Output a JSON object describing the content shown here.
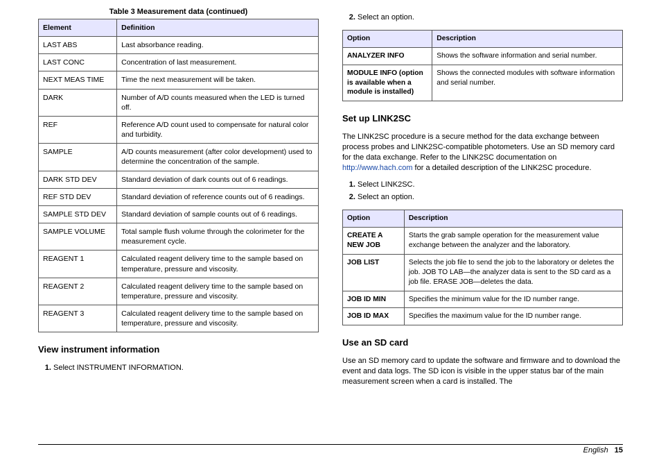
{
  "left": {
    "table_caption": "Table 3  Measurement data (continued)",
    "head": {
      "c1": "Element",
      "c2": "Definition"
    },
    "rows": [
      {
        "c1": "LAST ABS",
        "c2": "Last absorbance reading."
      },
      {
        "c1": "LAST CONC",
        "c2": "Concentration of last measurement."
      },
      {
        "c1": "NEXT MEAS TIME",
        "c2": "Time the next measurement will be taken."
      },
      {
        "c1": "DARK",
        "c2": "Number of A/D counts measured when the LED is turned off."
      },
      {
        "c1": "REF",
        "c2": "Reference A/D count used to compensate for natural color and turbidity."
      },
      {
        "c1": "SAMPLE",
        "c2": "A/D counts measurement (after color development) used to determine the concentration of the sample."
      },
      {
        "c1": "DARK STD DEV",
        "c2": "Standard deviation of dark counts out of 6 readings."
      },
      {
        "c1": "REF STD DEV",
        "c2": "Standard deviation of reference counts out of 6 readings."
      },
      {
        "c1": "SAMPLE STD DEV",
        "c2": "Standard deviation of sample counts out of 6 readings."
      },
      {
        "c1": "SAMPLE VOLUME",
        "c2": "Total sample flush volume through the colorimeter for the measurement cycle."
      },
      {
        "c1": "REAGENT 1",
        "c2": "Calculated reagent delivery time to the sample based on temperature, pressure and viscosity."
      },
      {
        "c1": "REAGENT 2",
        "c2": "Calculated reagent delivery time to the sample based on temperature, pressure and viscosity."
      },
      {
        "c1": "REAGENT 3",
        "c2": "Calculated reagent delivery time to the sample based on temperature, pressure and viscosity."
      }
    ],
    "heading": "View instrument information",
    "step1": "Select INSTRUMENT INFORMATION."
  },
  "right": {
    "step2": "Select an option.",
    "table1": {
      "head": {
        "c1": "Option",
        "c2": "Description"
      },
      "rows": [
        {
          "c1": "ANALYZER INFO",
          "c2": "Shows the software information and serial number."
        },
        {
          "c1": "MODULE INFO (option is available when a module is installed)",
          "c2": "Shows the connected modules with software information and serial number."
        }
      ]
    },
    "heading1": "Set up LINK2SC",
    "para1a": "The LINK2SC procedure is a secure method for the data exchange between process probes and LINK2SC-compatible photometers. Use an SD memory card for the data exchange. Refer to the LINK2SC documentation on ",
    "link1": "http://www.hach.com",
    "para1b": " for a detailed description of the LINK2SC procedure.",
    "stepA": "Select LINK2SC.",
    "stepB": "Select an option.",
    "table2": {
      "head": {
        "c1": "Option",
        "c2": "Description"
      },
      "rows": [
        {
          "c1": "CREATE A NEW JOB",
          "c2": "Starts the grab sample operation for the measurement value exchange between the analyzer and the laboratory."
        },
        {
          "c1": "JOB LIST",
          "c2": "Selects the job file to send the job to the laboratory or deletes the job. JOB TO LAB—the analyzer data is sent to the SD card as a job file. ERASE JOB—deletes the data."
        },
        {
          "c1": "JOB ID MIN",
          "c2": "Specifies the minimum value for the ID number range."
        },
        {
          "c1": "JOB ID MAX",
          "c2": "Specifies the maximum value for the ID number range."
        }
      ]
    },
    "heading2": "Use an SD card",
    "para2": "Use an SD memory card to update the software and firmware and to download the event and data logs. The SD icon is visible in the upper status bar of the main measurement screen when a card is installed. The"
  },
  "footer": {
    "lang": "English",
    "page": "15"
  }
}
